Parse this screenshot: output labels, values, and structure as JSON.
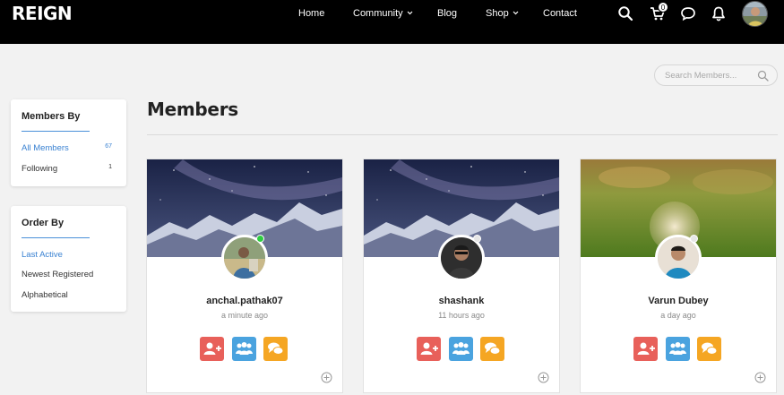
{
  "header": {
    "logo": "REIGN",
    "nav": [
      {
        "label": "Home",
        "dropdown": false
      },
      {
        "label": "Community",
        "dropdown": true
      },
      {
        "label": "Blog",
        "dropdown": false
      },
      {
        "label": "Shop",
        "dropdown": true
      },
      {
        "label": "Contact",
        "dropdown": false
      }
    ],
    "cart_count": "0",
    "icons": [
      "search-icon",
      "cart-icon",
      "chat-icon",
      "bell-icon"
    ]
  },
  "search": {
    "placeholder": "Search Members..."
  },
  "members_by": {
    "title": "Members By",
    "items": [
      {
        "label": "All Members",
        "count": "67",
        "active": true
      },
      {
        "label": "Following",
        "count": "1",
        "active": false
      }
    ]
  },
  "order_by": {
    "title": "Order By",
    "items": [
      {
        "label": "Last Active",
        "active": true
      },
      {
        "label": "Newest Registered",
        "active": false
      },
      {
        "label": "Alphabetical",
        "active": false
      }
    ]
  },
  "main": {
    "title": "Members"
  },
  "members": [
    {
      "name": "anchal.pathak07",
      "last_active": "a minute ago",
      "online": true
    },
    {
      "name": "shashank",
      "last_active": "11 hours ago",
      "online": false
    },
    {
      "name": "Varun Dubey",
      "last_active": "a day ago",
      "online": false
    }
  ],
  "colors": {
    "header_bg": "#000000",
    "accent_blue": "#3a82d2",
    "add_friend": "#e8605a",
    "groups": "#4aa3df",
    "message": "#f5a623",
    "online": "#2ecc40"
  }
}
